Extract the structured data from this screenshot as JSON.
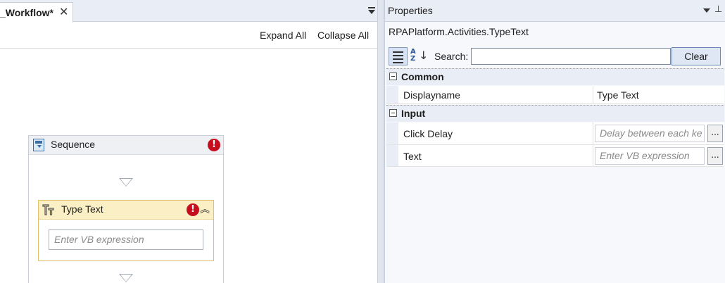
{
  "designer": {
    "tab": {
      "title": "_Workflow*",
      "close_glyph": "✕"
    },
    "toolbar": {
      "expand_all": "Expand All",
      "collapse_all": "Collapse All"
    },
    "sequence": {
      "title": "Sequence",
      "error_glyph": "!"
    },
    "type_text": {
      "title": "Type Text",
      "error_glyph": "!",
      "collapse_glyph": "︽",
      "input_placeholder": "Enter  VB expression"
    }
  },
  "properties": {
    "title": "Properties",
    "pin_glyph": "⊥",
    "activity_type": "RPAPlatform.Activities.TypeText",
    "search_label": "Search:",
    "search_value": "",
    "clear_label": "Clear",
    "sort_az_top": "A",
    "sort_az_bottom": "Z",
    "sort_arrow": "↓",
    "categories": [
      {
        "name": "Common",
        "rows": [
          {
            "name": "Displayname",
            "value": "Type Text"
          }
        ]
      },
      {
        "name": "Input",
        "rows": [
          {
            "name": "Click Delay",
            "placeholder": "Delay between each ke"
          },
          {
            "name": "Text",
            "placeholder": "Enter  VB expression"
          }
        ]
      }
    ],
    "ellipsis_label": "..."
  },
  "colors": {
    "accent": "#2b579a",
    "error": "#c50f1f",
    "activity_header": "#fbefc5",
    "activity_border": "#e3c168"
  }
}
